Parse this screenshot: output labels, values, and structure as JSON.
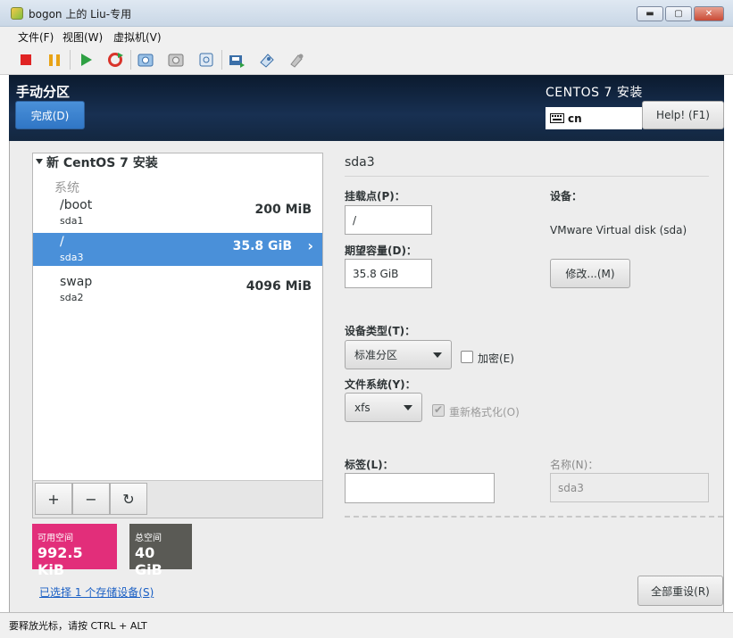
{
  "window": {
    "title": "bogon 上的 Liu-专用",
    "minimize": "▬",
    "restore": "▢",
    "close": "✕"
  },
  "menubar": [
    "文件(F)",
    "视图(W)",
    "虚拟机(V)"
  ],
  "toolbar": {
    "icons": [
      "stop-icon",
      "pause-icon",
      "play-icon",
      "restart-icon",
      "snapshot-icon",
      "revert-snapshot-icon",
      "snapshot-manager-icon",
      "usb-icon",
      "settings-icon",
      "network-icon"
    ],
    "colors": {
      "stop": "#e02424",
      "pause": "#e8a317",
      "play": "#2ea043",
      "restart": "#d9342b"
    }
  },
  "header": {
    "page_title": "手动分区",
    "done_button": "完成(D)",
    "product": "CENTOS 7 安装",
    "keyboard": "cn",
    "help_button": "Help! (F1)"
  },
  "partitions": {
    "install_title": "新 CentOS 7 安装",
    "group": "系统",
    "items": [
      {
        "mount": "/boot",
        "device": "sda1",
        "size": "200 MiB",
        "selected": false
      },
      {
        "mount": "/",
        "device": "sda3",
        "size": "35.8 GiB",
        "selected": true
      },
      {
        "mount": "swap",
        "device": "sda2",
        "size": "4096 MiB",
        "selected": false
      }
    ],
    "add": "+",
    "remove": "−",
    "refresh": "↻"
  },
  "space": {
    "available_label": "可用空间",
    "available_value": "992.5 KiB",
    "total_label": "总空间",
    "total_value": "40 GiB",
    "available_color": "#e22e7a",
    "total_color": "#5a5a55"
  },
  "storage_link": "已选择 1 个存储设备(S)",
  "detail": {
    "title": "sda3",
    "mount_label": "挂载点(P)：",
    "mount_value": "/",
    "capacity_label": "期望容量(D)：",
    "capacity_value": "35.8 GiB",
    "device_label": "设备：",
    "device_value": "VMware Virtual disk (sda)",
    "modify_button": "修改...(M)",
    "device_type_label": "设备类型(T)：",
    "device_type_value": "标准分区",
    "encrypt_label": "加密(E)",
    "encrypt_checked": false,
    "fs_label": "文件系统(Y)：",
    "fs_value": "xfs",
    "reformat_label": "重新格式化(O)",
    "reformat_checked": true,
    "tag_label": "标签(L)：",
    "tag_value": "",
    "name_label": "名称(N)：",
    "name_value": "sda3",
    "reset_button": "全部重设(R)"
  },
  "statusbar": "要释放光标，请按 CTRL + ALT"
}
